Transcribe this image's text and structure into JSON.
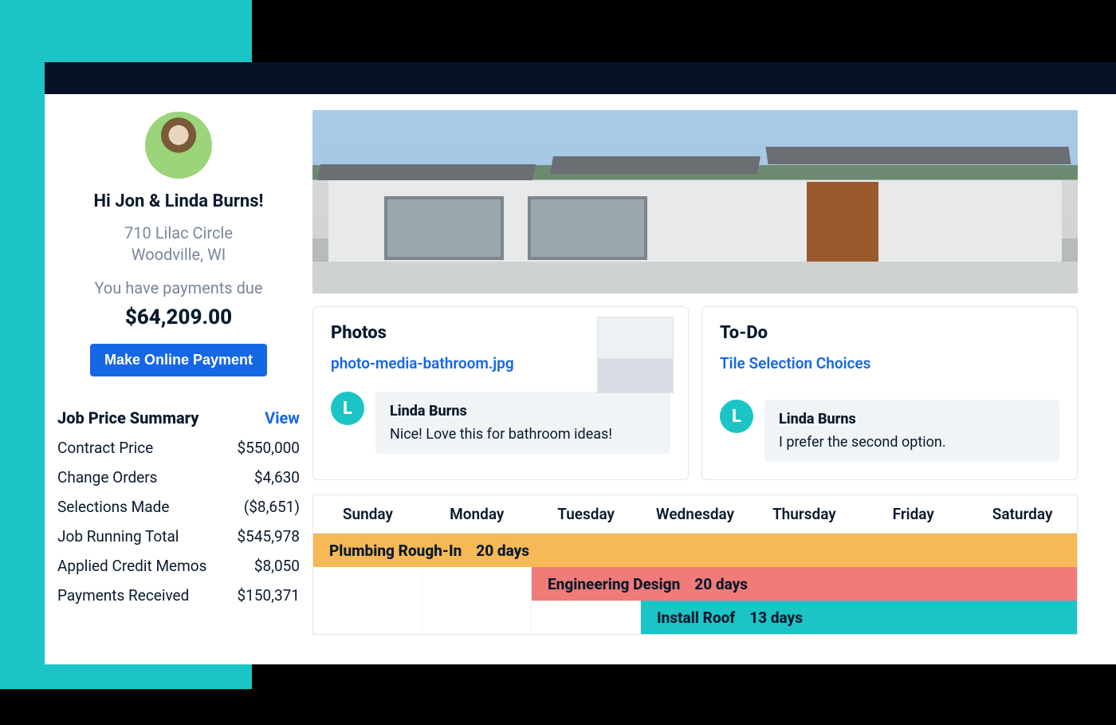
{
  "sidebar": {
    "greeting": "Hi Jon & Linda Burns!",
    "address_line1": "710 Lilac Circle",
    "address_line2": "Woodville, WI",
    "due_message": "You have payments due",
    "due_amount": "$64,209.00",
    "pay_button": "Make Online Payment"
  },
  "summary": {
    "title": "Job Price Summary",
    "view_label": "View",
    "rows": [
      {
        "label": "Contract Price",
        "value": "$550,000"
      },
      {
        "label": "Change Orders",
        "value": "$4,630"
      },
      {
        "label": "Selections Made",
        "value": "($8,651)"
      },
      {
        "label": "Job Running Total",
        "value": "$545,978"
      },
      {
        "label": "Applied Credit Memos",
        "value": "$8,050"
      },
      {
        "label": "Payments Received",
        "value": "$150,371"
      }
    ]
  },
  "cards": {
    "photos": {
      "title": "Photos",
      "file_link": "photo-media-bathroom.jpg",
      "commenter_initial": "L",
      "commenter_name": "Linda Burns",
      "comment_text": "Nice! Love this for bathroom ideas!"
    },
    "todo": {
      "title": "To-Do",
      "item_link": "Tile Selection Choices",
      "commenter_initial": "L",
      "commenter_name": "Linda Burns",
      "comment_text": "I prefer the second option."
    }
  },
  "calendar": {
    "days": [
      "Sunday",
      "Monday",
      "Tuesday",
      "Wednesday",
      "Thursday",
      "Friday",
      "Saturday"
    ],
    "bars": [
      {
        "name": "Plumbing Rough-In",
        "duration": "20 days",
        "color": "orange",
        "start_pct": 0,
        "width_pct": 100
      },
      {
        "name": "Engineering Design",
        "duration": "20 days",
        "color": "red",
        "start_pct": 28.6,
        "width_pct": 71.4
      },
      {
        "name": "Install Roof",
        "duration": "13 days",
        "color": "teal",
        "start_pct": 42.9,
        "width_pct": 57.1
      }
    ]
  }
}
